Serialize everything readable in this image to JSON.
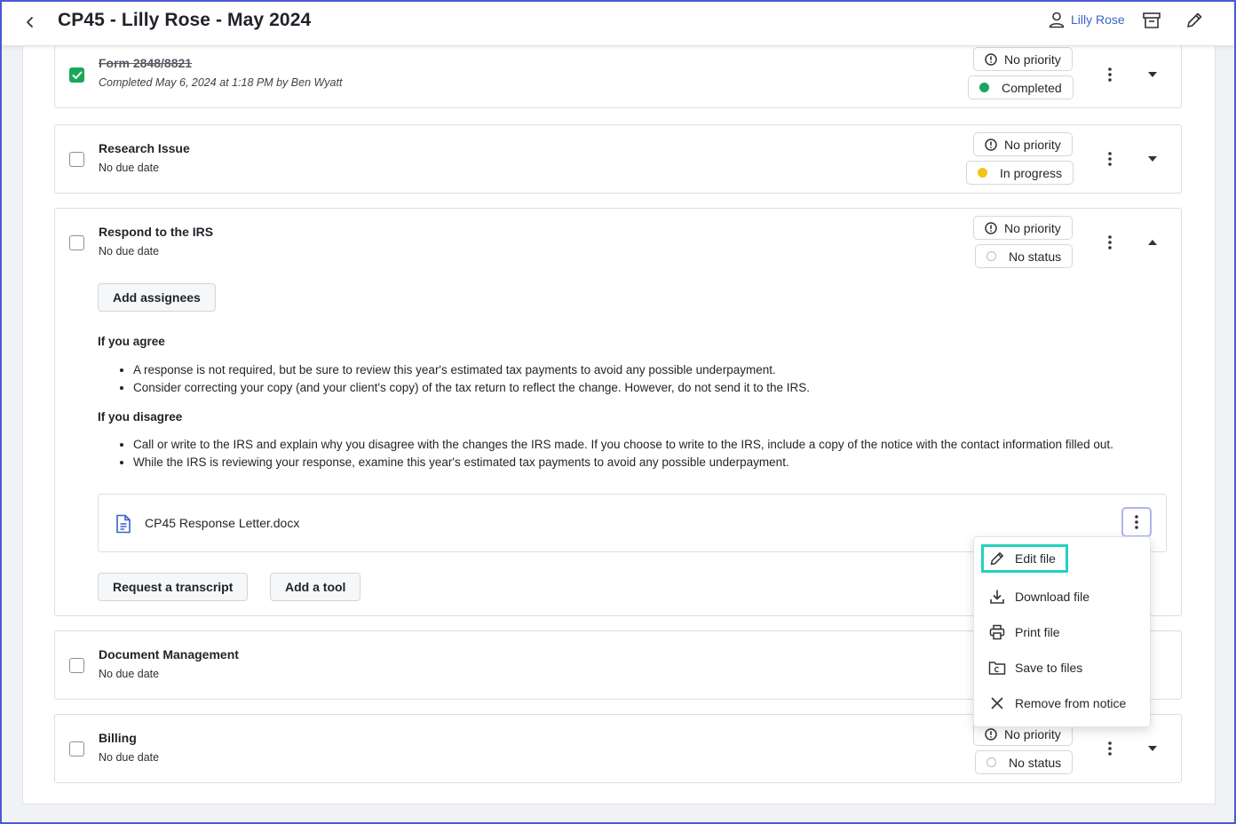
{
  "header": {
    "title": "CP45 - Lilly Rose - May 2024",
    "user_name": "Lilly Rose",
    "accent": "#3a63c9"
  },
  "tasks": [
    {
      "title": "Form 2848/8821",
      "subtitle": "Completed May 6, 2024 at 1:18 PM by Ben Wyatt",
      "completed": true,
      "priority": "No priority",
      "status": "Completed",
      "status_color": "#1aa75a"
    },
    {
      "title": "Research Issue",
      "subtitle": "No due date",
      "completed": false,
      "priority": "No priority",
      "status": "In progress",
      "status_color": "#f0c419"
    },
    {
      "title": "Respond to the IRS",
      "subtitle": "No due date",
      "completed": false,
      "priority": "No priority",
      "status": "No status"
    },
    {
      "title": "Document Management",
      "subtitle": "No due date",
      "completed": false
    },
    {
      "title": "Billing",
      "subtitle": "No due date",
      "completed": false,
      "priority": "No priority",
      "status": "No status"
    }
  ],
  "expanded": {
    "add_assignees": "Add assignees",
    "agree_heading": "If you agree",
    "agree_bullets": [
      "A response is not required, but be sure to review this year's estimated tax payments to avoid any possible underpayment.",
      "Consider correcting your copy (and your client's copy) of the tax return to reflect the change. However, do not send it to the IRS."
    ],
    "disagree_heading": "If you disagree",
    "disagree_bullets": [
      "Call or write to the IRS and explain why you disagree with the changes the IRS made. If you choose to write to the IRS, include a copy of the notice with the contact information filled out.",
      "While the IRS is reviewing your response, examine this year's estimated tax payments to avoid any possible underpayment."
    ],
    "file_name": "CP45 Response Letter.docx",
    "request_transcript": "Request a transcript",
    "add_tool": "Add a tool"
  },
  "file_menu": {
    "items": [
      {
        "label": "Edit file",
        "icon": "pencil-icon"
      },
      {
        "label": "Download file",
        "icon": "download-icon"
      },
      {
        "label": "Print file",
        "icon": "printer-icon"
      },
      {
        "label": "Save to files",
        "icon": "folder-icon"
      },
      {
        "label": "Remove from notice",
        "icon": "close-icon"
      }
    ],
    "highlight_color": "#22d3c0"
  }
}
